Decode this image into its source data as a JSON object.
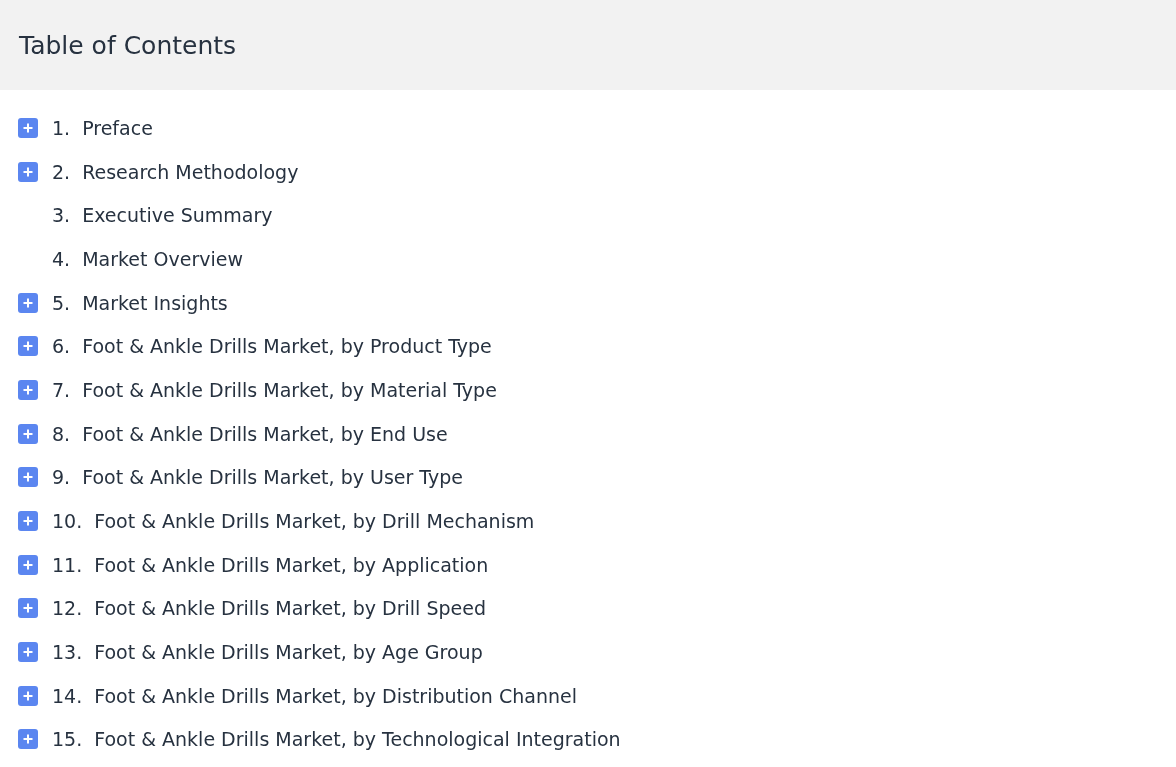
{
  "header": {
    "title": "Table of Contents"
  },
  "items": [
    {
      "number": "1.",
      "title": "Preface",
      "expandable": true
    },
    {
      "number": "2.",
      "title": "Research Methodology",
      "expandable": true
    },
    {
      "number": "3.",
      "title": "Executive Summary",
      "expandable": false
    },
    {
      "number": "4.",
      "title": "Market Overview",
      "expandable": false
    },
    {
      "number": "5.",
      "title": "Market Insights",
      "expandable": true
    },
    {
      "number": "6.",
      "title": "Foot & Ankle Drills Market, by Product Type",
      "expandable": true
    },
    {
      "number": "7.",
      "title": "Foot & Ankle Drills Market, by Material Type",
      "expandable": true
    },
    {
      "number": "8.",
      "title": "Foot & Ankle Drills Market, by End Use",
      "expandable": true
    },
    {
      "number": "9.",
      "title": "Foot & Ankle Drills Market, by User Type",
      "expandable": true
    },
    {
      "number": "10.",
      "title": "Foot & Ankle Drills Market, by Drill Mechanism",
      "expandable": true
    },
    {
      "number": "11.",
      "title": "Foot & Ankle Drills Market, by Application",
      "expandable": true
    },
    {
      "number": "12.",
      "title": "Foot & Ankle Drills Market, by Drill Speed",
      "expandable": true
    },
    {
      "number": "13.",
      "title": "Foot & Ankle Drills Market, by Age Group",
      "expandable": true
    },
    {
      "number": "14.",
      "title": "Foot & Ankle Drills Market, by Distribution Channel",
      "expandable": true
    },
    {
      "number": "15.",
      "title": "Foot & Ankle Drills Market, by Technological Integration",
      "expandable": true
    }
  ]
}
